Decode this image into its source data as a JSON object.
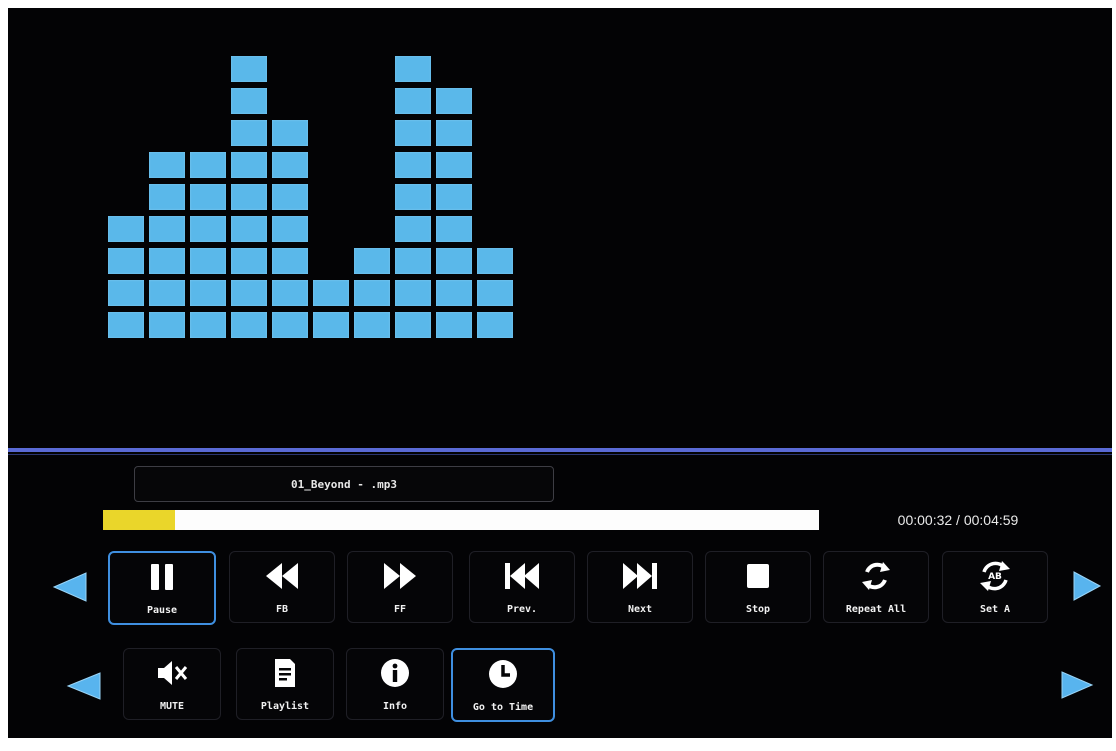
{
  "equalizer": {
    "bar_levels": [
      4,
      6,
      6,
      9,
      7,
      2,
      3,
      9,
      8,
      3
    ],
    "max_level": 9,
    "bar_color": "#5ab8ea"
  },
  "track": {
    "filename": "01_Beyond - .mp3",
    "current_time": "00:00:32",
    "separator": "/",
    "total_time": "00:04:59",
    "time_display": "00:00:32 / 00:04:59",
    "progress_fraction": 0.1
  },
  "controls_row1": {
    "buttons": [
      {
        "label": "Pause",
        "icon": "pause-icon",
        "selected": true
      },
      {
        "label": "FB",
        "icon": "fast-backward-icon"
      },
      {
        "label": "FF",
        "icon": "fast-forward-icon"
      },
      {
        "label": "Prev.",
        "icon": "skip-previous-icon"
      },
      {
        "label": "Next",
        "icon": "skip-next-icon"
      },
      {
        "label": "Stop",
        "icon": "stop-icon"
      },
      {
        "label": "Repeat All",
        "icon": "repeat-icon"
      },
      {
        "label": "Set A",
        "icon": "ab-repeat-icon",
        "icon_text": "AB"
      }
    ]
  },
  "controls_row2": {
    "buttons": [
      {
        "label": "MUTE",
        "icon": "mute-icon"
      },
      {
        "label": "Playlist",
        "icon": "playlist-icon"
      },
      {
        "label": "Info",
        "icon": "info-icon"
      },
      {
        "label": "Go to Time",
        "icon": "clock-icon",
        "selected": true
      }
    ]
  },
  "colors": {
    "accent": "#3f8fe0",
    "divider": "#5a6ad6",
    "progress_fill": "#ead62a",
    "arrow": "#58b4ee"
  }
}
